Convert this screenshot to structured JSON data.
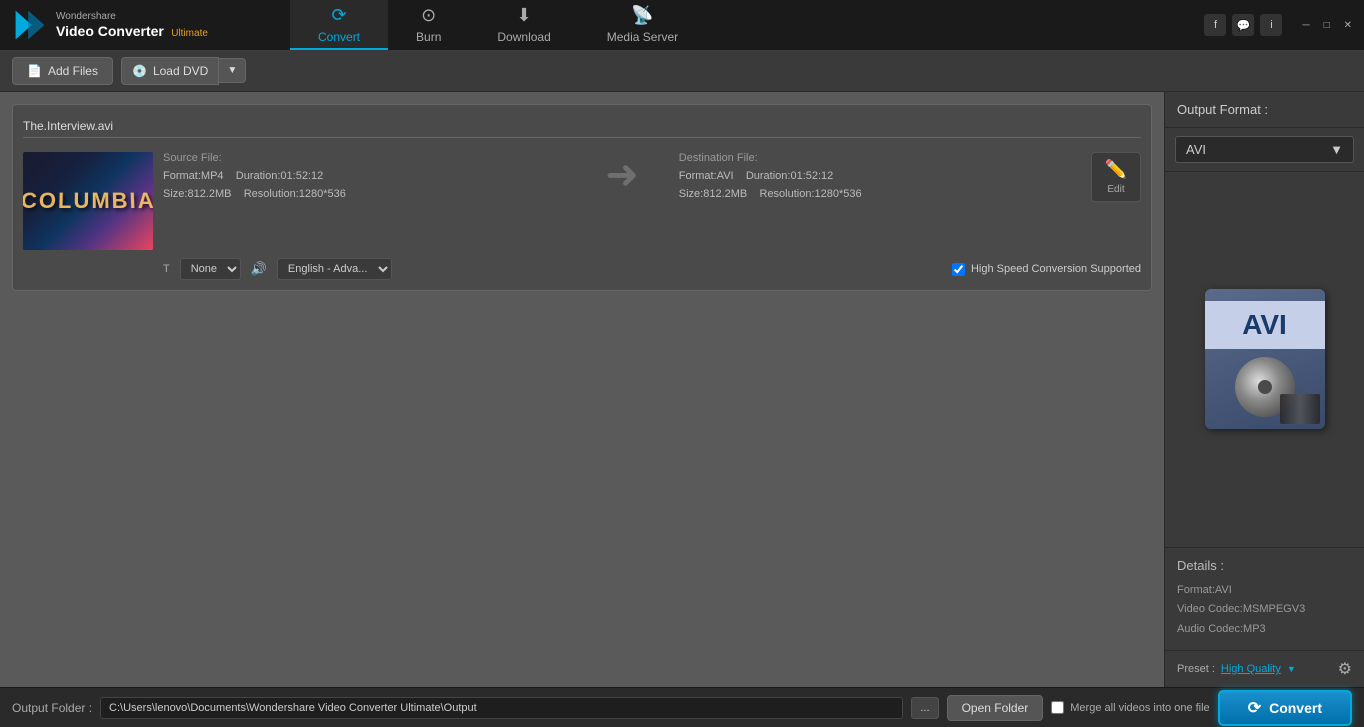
{
  "app": {
    "logo_wondershare": "Wondershare",
    "logo_product": "Video Converter",
    "logo_ultimate": "Ultimate"
  },
  "social": {
    "facebook": "f",
    "chat": "💬",
    "info": "i"
  },
  "window_controls": {
    "minimize": "─",
    "maximize": "□",
    "close": "✕"
  },
  "nav": {
    "tabs": [
      {
        "id": "convert",
        "label": "Convert",
        "active": true
      },
      {
        "id": "burn",
        "label": "Burn",
        "active": false
      },
      {
        "id": "download",
        "label": "Download",
        "active": false
      },
      {
        "id": "media-server",
        "label": "Media Server",
        "active": false
      }
    ]
  },
  "toolbar": {
    "add_files_label": "Add Files",
    "load_dvd_label": "Load DVD"
  },
  "file_item": {
    "filename": "The.Interview.avi",
    "source": {
      "label": "Source File:",
      "format_label": "Format:",
      "format_value": "MP4",
      "duration_label": "Duration:",
      "duration_value": "01:52:12",
      "size_label": "Size:",
      "size_value": "812.2MB",
      "resolution_label": "Resolution:",
      "resolution_value": "1280*536"
    },
    "destination": {
      "label": "Destination File:",
      "format_label": "Format:",
      "format_value": "AVI",
      "duration_label": "Duration:",
      "duration_value": "01:52:12",
      "size_label": "Size:",
      "size_value": "812.2MB",
      "resolution_label": "Resolution:",
      "resolution_value": "1280*536"
    },
    "edit_label": "Edit",
    "subtitle_options": [
      "None"
    ],
    "subtitle_current": "None",
    "audio_current": "English - Adva...",
    "high_speed_label": "High Speed Conversion Supported"
  },
  "right_panel": {
    "output_format_label": "Output Format :",
    "format_name": "AVI",
    "details_label": "Details :",
    "format_detail": "Format:AVI",
    "video_codec_detail": "Video Codec:MSMPEGV3",
    "audio_codec_detail": "Audio Codec:MP3",
    "preset_label": "Preset :",
    "preset_value": "High Quality"
  },
  "bottom_bar": {
    "output_folder_label": "Output Folder :",
    "output_path": "C:\\Users\\lenovo\\Documents\\Wondershare Video Converter Ultimate\\Output",
    "more_btn": "...",
    "open_folder_btn": "Open Folder",
    "merge_label": "Merge all videos into one file",
    "convert_btn": "Convert"
  }
}
